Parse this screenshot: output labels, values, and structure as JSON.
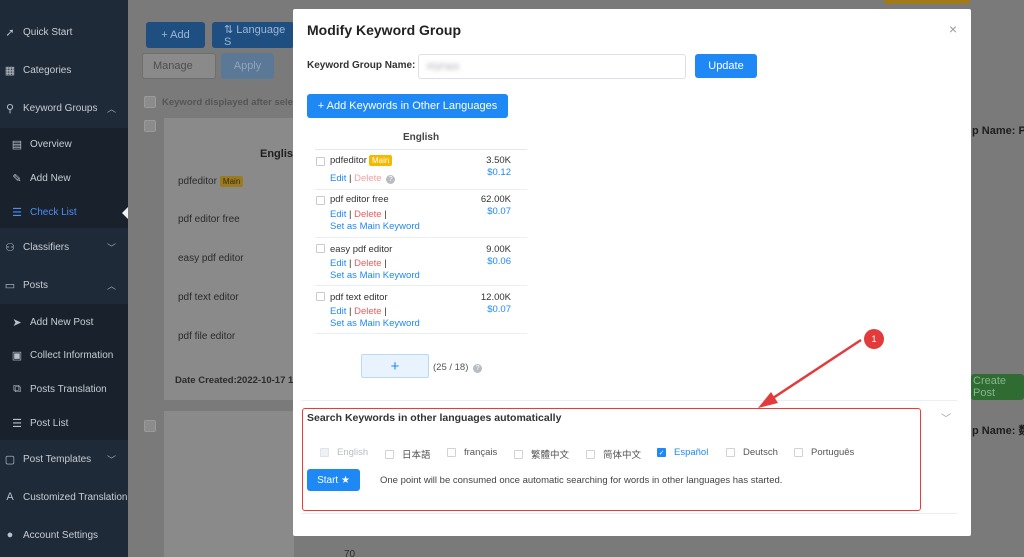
{
  "sidebar": {
    "items": [
      {
        "label": "Quick Start",
        "icon": "rocket-icon"
      },
      {
        "label": "Categories",
        "icon": "grid-icon"
      },
      {
        "label": "Keyword Groups",
        "icon": "search-icon"
      },
      {
        "label": "Overview",
        "icon": "document-icon"
      },
      {
        "label": "Add New",
        "icon": "edit-icon"
      },
      {
        "label": "Check List",
        "icon": "list-icon"
      },
      {
        "label": "Classifiers",
        "icon": "hierarchy-icon"
      },
      {
        "label": "Posts",
        "icon": "folder-icon"
      },
      {
        "label": "Add New Post",
        "icon": "send-icon"
      },
      {
        "label": "Collect Information",
        "icon": "clipboard-icon"
      },
      {
        "label": "Posts Translation",
        "icon": "translate-icon"
      },
      {
        "label": "Post List",
        "icon": "list-icon"
      },
      {
        "label": "Post Templates",
        "icon": "template-icon"
      },
      {
        "label": "Customized Translation",
        "icon": "translate-icon"
      },
      {
        "label": "Account Settings",
        "icon": "user-icon"
      }
    ]
  },
  "background": {
    "add_label": "+ Add",
    "language_label": "⇅ Language S",
    "manage_label": "Manage",
    "apply_label": "Apply",
    "keyword_note": "Keyword displayed after sele",
    "col_header": "Englis",
    "rows": [
      "pdfeditor",
      "pdf editor free",
      "easy pdf editor",
      "pdf text editor",
      "pdf file editor"
    ],
    "main_tag": "Main",
    "date_created": "Date Created:2022-10-17 1",
    "group_name_1": "p Name: P",
    "group_name_2": "p Name: 数",
    "create_post": "Create Post",
    "bottom_num": "70"
  },
  "modal": {
    "title": "Modify Keyword Group",
    "close": "×",
    "name_label": "Keyword Group Name:",
    "name_value": "PDFWX",
    "update_label": "Update",
    "add_keywords_label": "+ Add Keywords in Other Languages",
    "table_header": "English",
    "keywords": [
      {
        "name": "pdfeditor",
        "main": "Main",
        "volume": "3.50K",
        "cpc": "$0.12",
        "edit": "Edit",
        "delete": "Delete",
        "sep": "|",
        "set_main": ""
      },
      {
        "name": "pdf editor free",
        "main": "",
        "volume": "62.00K",
        "cpc": "$0.07",
        "edit": "Edit",
        "delete": "Delete",
        "sep": "|",
        "set_main": "Set as Main Keyword"
      },
      {
        "name": "easy pdf editor",
        "main": "",
        "volume": "9.00K",
        "cpc": "$0.06",
        "edit": "Edit",
        "delete": "Delete",
        "sep": "|",
        "set_main": "Set as Main Keyword"
      },
      {
        "name": "pdf text editor",
        "main": "",
        "volume": "12.00K",
        "cpc": "$0.07",
        "edit": "Edit",
        "delete": "Delete",
        "sep": "|",
        "set_main": "Set as Main Keyword"
      }
    ],
    "plus_label": "+",
    "count": "(25 / 18)",
    "search_title": "Search Keywords in other languages automatically",
    "languages": [
      {
        "label": "English",
        "state": "disabled"
      },
      {
        "label": "日本語",
        "state": "unchecked"
      },
      {
        "label": "français",
        "state": "unchecked"
      },
      {
        "label": "繁體中文",
        "state": "unchecked"
      },
      {
        "label": "简体中文",
        "state": "unchecked"
      },
      {
        "label": "Español",
        "state": "checked"
      },
      {
        "label": "Deutsch",
        "state": "unchecked"
      },
      {
        "label": "Português",
        "state": "unchecked"
      }
    ],
    "start_label": "Start ★",
    "start_note": "One point will be consumed once automatic searching for words in other languages has started."
  },
  "annotation": {
    "badge": "1"
  },
  "colors": {
    "accent": "#1e88f5",
    "sidebar": "#1f2a38",
    "main_tag": "#f5b900",
    "annotation": "#e33b3b"
  }
}
